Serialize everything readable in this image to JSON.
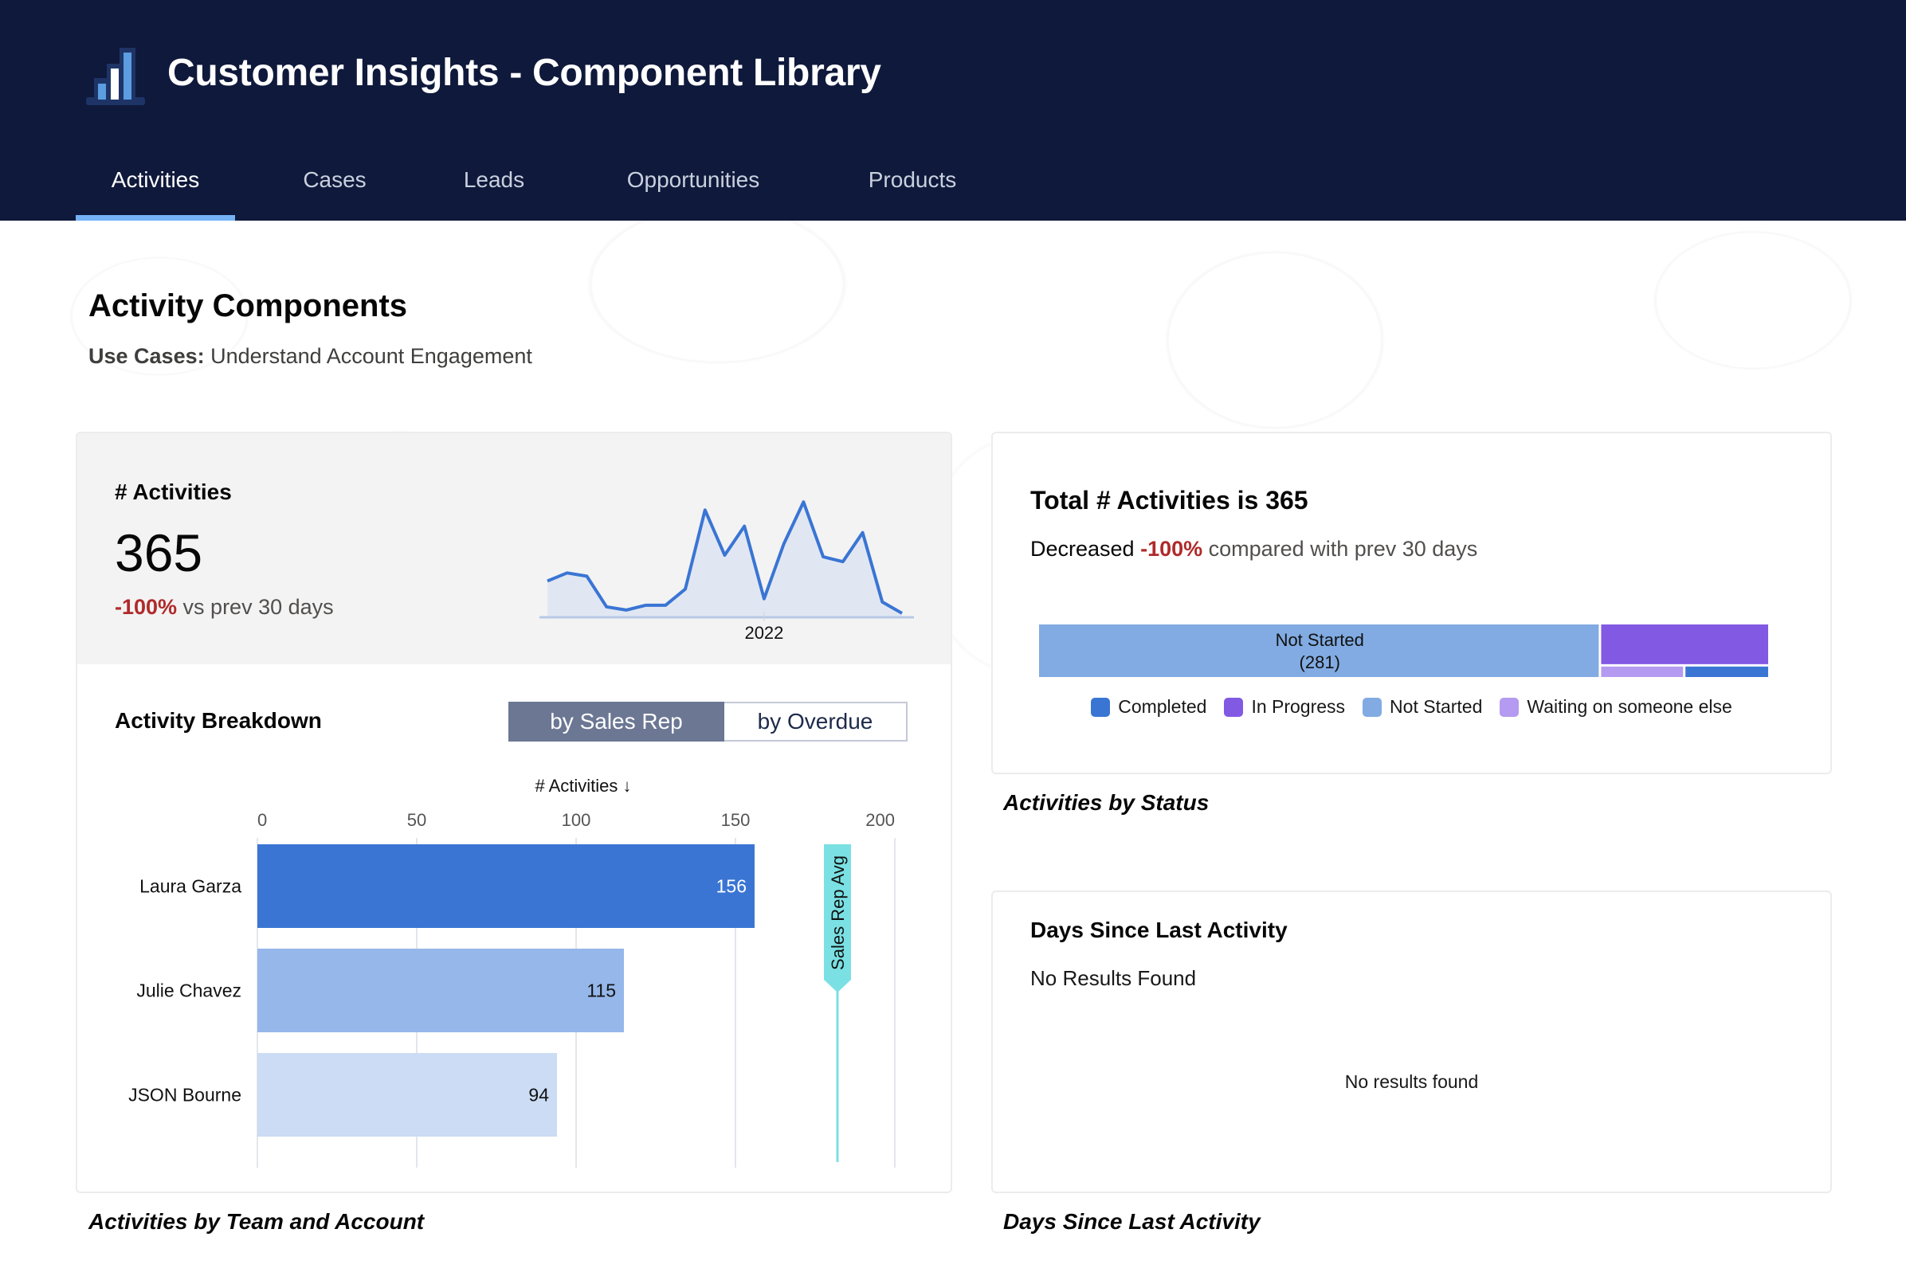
{
  "app": {
    "title": "Customer Insights - Component Library",
    "logo_icon": "bar-chart-icon"
  },
  "nav": {
    "tabs": [
      {
        "label": "Activities",
        "active": true
      },
      {
        "label": "Cases",
        "active": false
      },
      {
        "label": "Leads",
        "active": false
      },
      {
        "label": "Opportunities",
        "active": false
      },
      {
        "label": "Products",
        "active": false
      }
    ]
  },
  "page": {
    "title": "Activity Components",
    "use_cases_label": "Use Cases:",
    "use_cases_value": "Understand Account Engagement"
  },
  "colors": {
    "header_bg": "#0f193b",
    "tab_underline": "#74b1f5",
    "negative": "#b02a2a",
    "bar_primary": "#3a75d4",
    "bar_secondary": "#95b7ea",
    "bar_tertiary": "#cbdcf4",
    "avg_line": "#7ae0e3",
    "completed": "#3a75d4",
    "in_progress": "#8259e3",
    "not_started": "#81abe2",
    "waiting": "#b49af0"
  },
  "kpi": {
    "label": "# Activities",
    "value": "365",
    "delta": "-100%",
    "delta_suffix": " vs prev 30 days"
  },
  "breakdown": {
    "title": "Activity Breakdown",
    "toggle": [
      {
        "label": "by Sales Rep",
        "active": true
      },
      {
        "label": "by Overdue",
        "active": false
      }
    ]
  },
  "captions": {
    "left": "Activities by Team and Account",
    "right_top": "Activities by Status",
    "right_bottom": "Days Since Last Activity"
  },
  "status_card": {
    "title": "Total # Activities is 365",
    "sub_lead": "Decreased ",
    "sub_delta": "-100%",
    "sub_tail": " compared with prev 30 days"
  },
  "days_card": {
    "title": "Days Since Last Activity",
    "subtitle": "No Results Found",
    "empty": "No results found"
  },
  "chart_data": [
    {
      "type": "area",
      "title": "# Activities trend",
      "xlabel": "",
      "ylabel": "",
      "x_tick_labels": [
        "2022"
      ],
      "x_tick_index": 11,
      "values": [
        22,
        27,
        25,
        6,
        4,
        7,
        7,
        17,
        66,
        38,
        56,
        11,
        45,
        71,
        37,
        34,
        52,
        9,
        2
      ],
      "ylim": [
        0,
        80
      ],
      "grid": false
    },
    {
      "type": "bar",
      "orientation": "horizontal",
      "title": "",
      "xlabel": "# Activities ↓",
      "categories": [
        "Laura Garza",
        "Julie Chavez",
        "JSON Bourne"
      ],
      "values": [
        156,
        115,
        94
      ],
      "x_ticks": [
        0,
        50,
        100,
        150,
        200
      ],
      "xlim": [
        0,
        200
      ],
      "reference_line": {
        "label": "Sales Rep Avg",
        "value": 182
      },
      "grid": true
    },
    {
      "type": "treemap",
      "title": "Activities by Status",
      "categories": [
        "Not Started",
        "In Progress",
        "Waiting on someone else",
        "Completed"
      ],
      "values": [
        281,
        66,
        9,
        9
      ],
      "labels_shown": [
        {
          "name": "Not Started",
          "value": "(281)"
        }
      ],
      "legend": [
        "Completed",
        "In Progress",
        "Not Started",
        "Waiting on someone else"
      ],
      "legend_position": "bottom"
    }
  ]
}
